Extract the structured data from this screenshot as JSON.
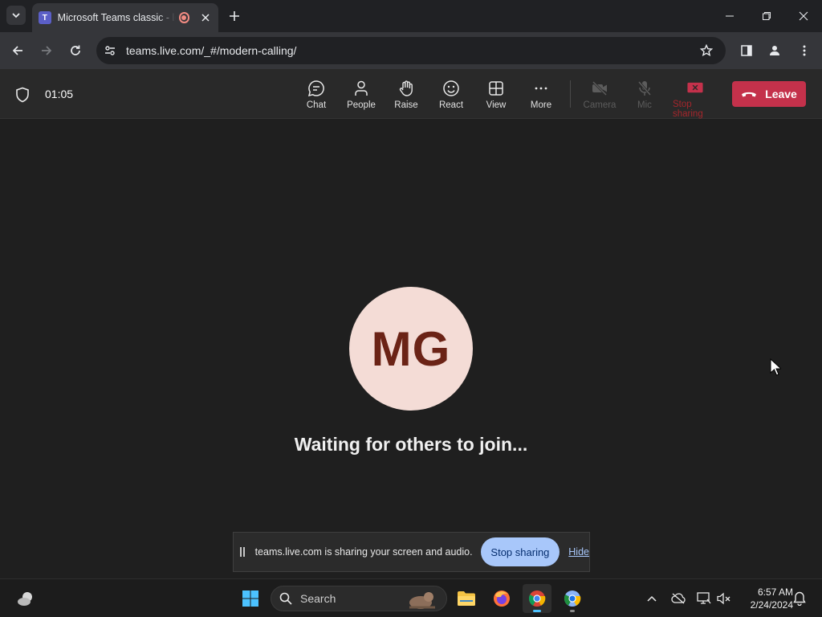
{
  "browser": {
    "tab_title": "Microsoft Teams classic - lo",
    "tab_favicon": "T",
    "url": "teams.live.com/_#/modern-calling/"
  },
  "meeting": {
    "timer": "01:05",
    "buttons": {
      "chat": "Chat",
      "people": "People",
      "raise": "Raise",
      "react": "React",
      "view": "View",
      "more": "More",
      "camera": "Camera",
      "mic": "Mic",
      "stop_sharing": "Stop sharing",
      "leave": "Leave"
    }
  },
  "stage": {
    "avatar_initials": "MG",
    "status": "Waiting for others to join..."
  },
  "share_bar": {
    "message": "teams.live.com is sharing your screen and audio.",
    "stop_label": "Stop sharing",
    "hide_label": "Hide"
  },
  "taskbar": {
    "search_label": "Search",
    "time": "6:57 AM",
    "date": "2/24/2024"
  },
  "colors": {
    "leave": "#c4314b",
    "avatar_bg": "#f4dcd6",
    "avatar_text": "#6b2316",
    "share_button": "#a8c7fa"
  }
}
